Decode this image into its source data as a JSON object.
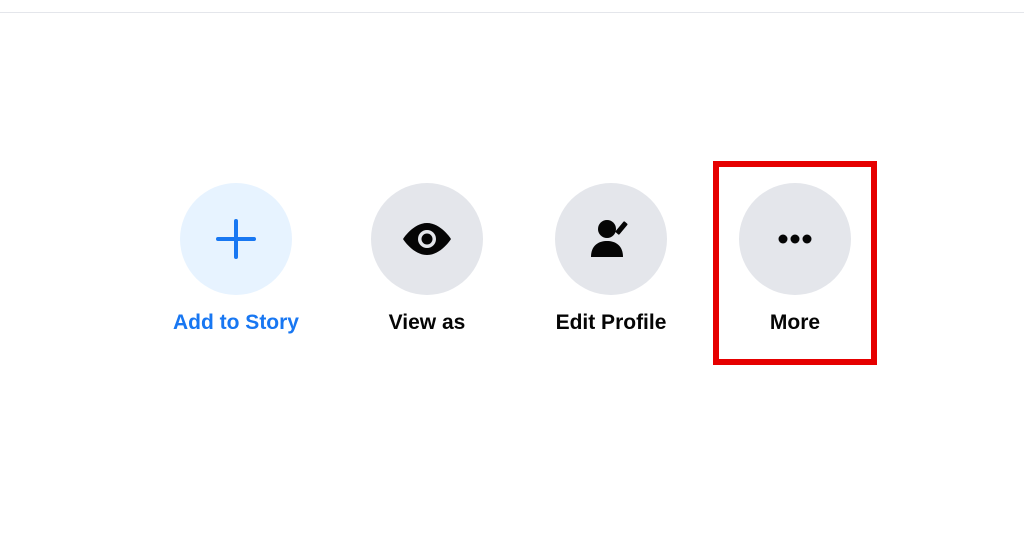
{
  "actions": {
    "add_to_story": {
      "label": "Add to Story",
      "icon": "plus-icon"
    },
    "view_as": {
      "label": "View as",
      "icon": "eye-icon"
    },
    "edit_profile": {
      "label": "Edit Profile",
      "icon": "user-edit-icon"
    },
    "more": {
      "label": "More",
      "icon": "dots-icon",
      "highlighted": true
    }
  },
  "colors": {
    "accent_blue": "#1877f2",
    "light_blue_bg": "#e7f3ff",
    "gray_bg": "#e4e6eb",
    "text_dark": "#050505",
    "highlight_border": "#e60000"
  }
}
